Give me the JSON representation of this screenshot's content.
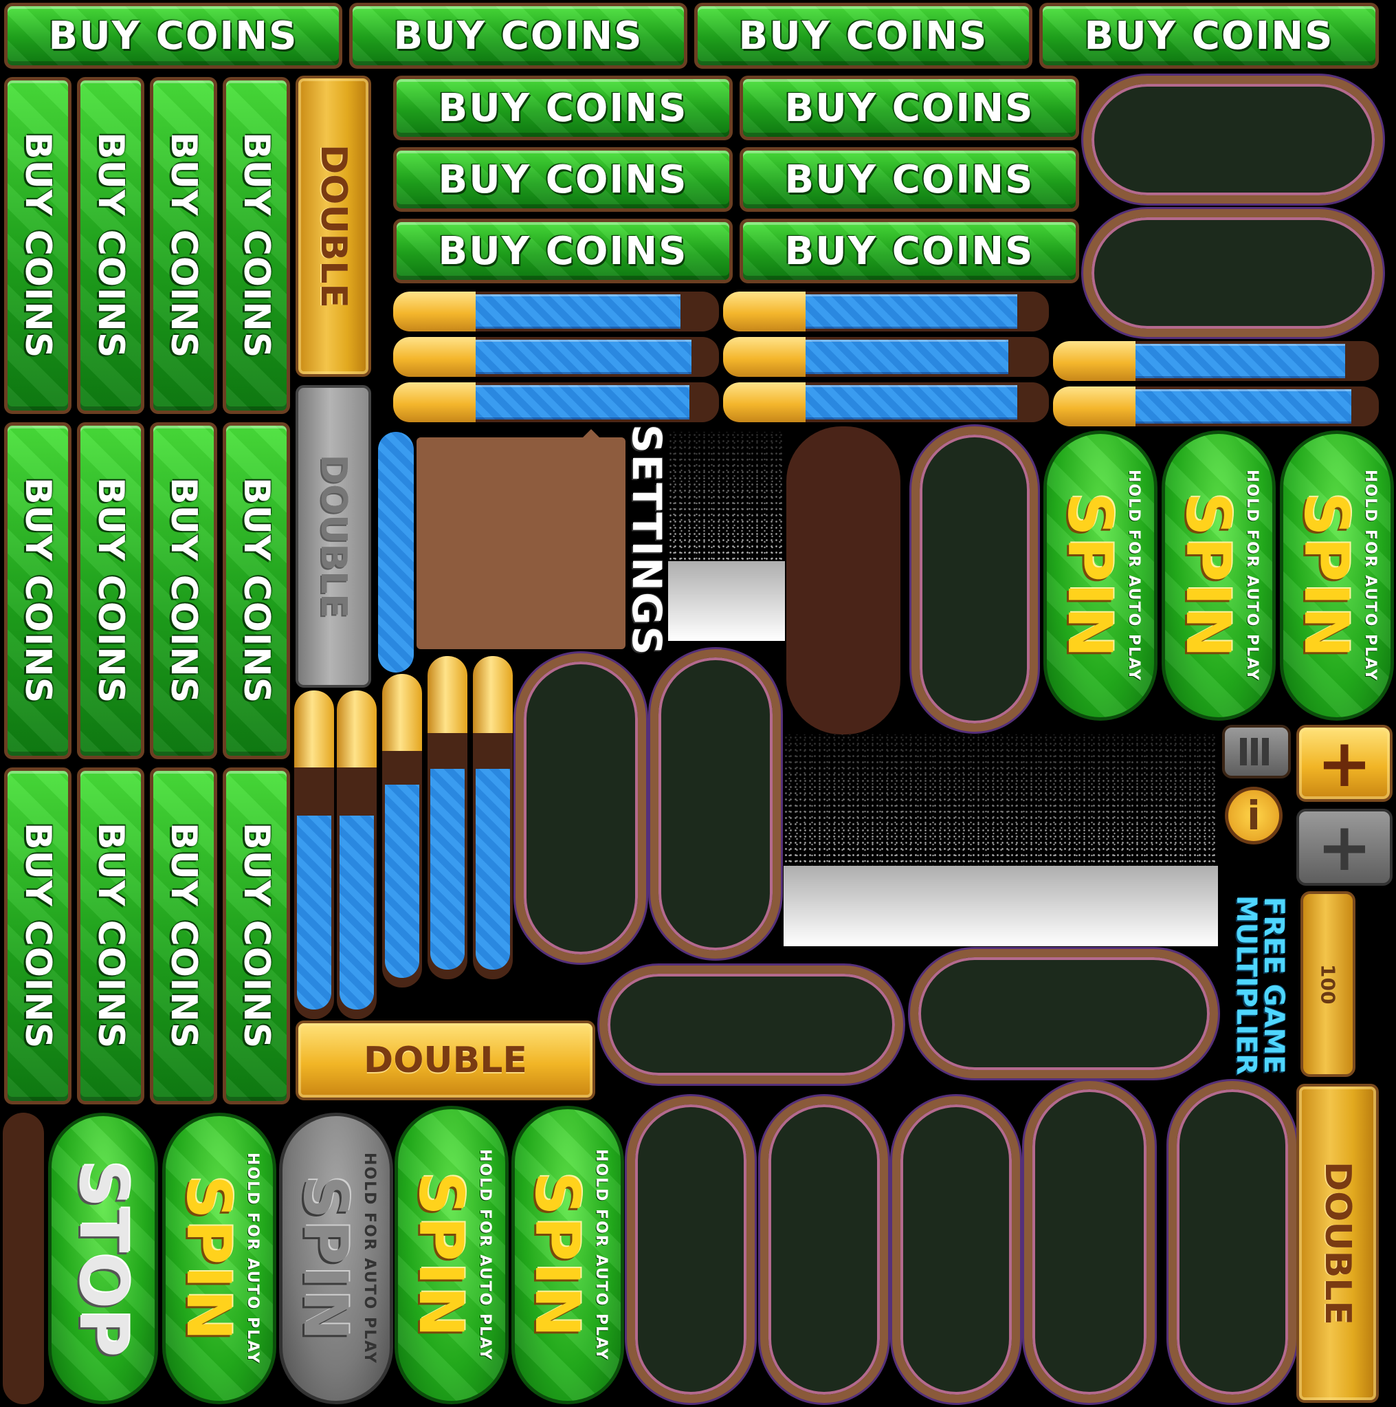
{
  "sprite_sheet": {
    "buy_coins_label": "BUY COINS",
    "double_label": "DOUBLE",
    "settings_label": "SETTINGS",
    "spin_label": "SPIN",
    "spin_sub_label": "HOLD FOR AUTO PLAY",
    "stop_label": "STOP",
    "free_game_multiplier_label": "FREE GAME MULTIPLIER",
    "multiplier_value": "100",
    "plus_label": "+",
    "info_label": "i",
    "icons": [
      "menu-icon",
      "info-icon",
      "plus-icon",
      "plus-icon-disabled"
    ],
    "colors": {
      "button_green": "#1fa51c",
      "button_gold": "#f1b526",
      "bar_blue": "#2a88e0",
      "panel_dark": "#1c2a1c",
      "frame_brown": "#8a5a3a",
      "frame_purple": "#b46a8e",
      "spin_yellow": "#ffd21c",
      "multiplier_cyan": "#4fd6ff"
    },
    "bar_fill_levels": [
      0.95,
      0.98,
      1.0,
      0.94,
      0.97,
      0.99,
      0.98,
      1.0
    ],
    "vertical_bar_fill_levels": [
      0.8,
      0.8,
      0.85,
      0.85,
      0.85,
      0.85
    ]
  }
}
